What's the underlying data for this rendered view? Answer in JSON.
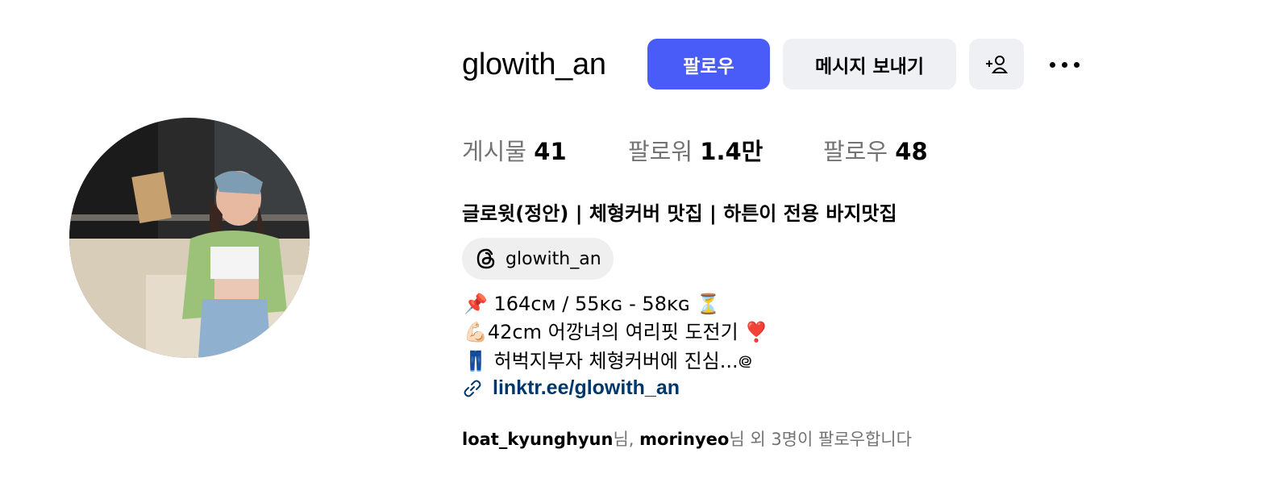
{
  "profile": {
    "username": "glowith_an",
    "follow_label": "팔로우",
    "message_label": "메시지 보내기",
    "suggest_icon": "add-person-icon",
    "more_icon": "more-horizontal-icon"
  },
  "stats": {
    "posts_label": "게시물",
    "posts_value": "41",
    "followers_label": "팔로워",
    "followers_value": "1.4만",
    "following_label": "팔로우",
    "following_value": "48"
  },
  "bio": {
    "full_name": "글로윗(정안) | 체형커버 맛집 | 하튼이 전용 바지맛집",
    "threads_handle": "glowith_an",
    "lines": [
      "📌 164ᴄᴍ / 55ᴋɢ - 58ᴋɢ ⏳",
      "💪🏻42cm 어깡녀의 여리핏 도전기 ❣️",
      "👖 허벅지부자 체형커버에 진심...᪤"
    ],
    "link_text": "linktr.ee/glowith_an"
  },
  "followed_by": {
    "user1": "loat_kyunghyun",
    "sep1": "님, ",
    "user2": "morinyeo",
    "suffix": "님 외 3명이 팔로우합니다"
  },
  "colors": {
    "follow_button": "#4a5cf7",
    "secondary_button": "#eff0f3",
    "muted_text": "#737373",
    "link_text": "#00376b"
  }
}
